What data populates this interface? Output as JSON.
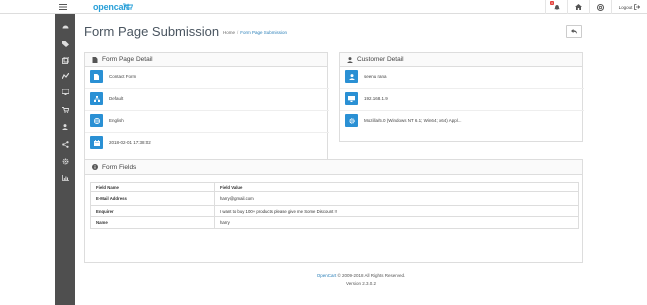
{
  "header": {
    "logo_text": "opencart",
    "notification_count": "4",
    "logout_label": "Logout"
  },
  "sidebar": {
    "items": [
      {
        "icon": "dashboard-icon"
      },
      {
        "icon": "tags-icon"
      },
      {
        "icon": "puzzle-icon"
      },
      {
        "icon": "design-icon"
      },
      {
        "icon": "desktop-icon"
      },
      {
        "icon": "cart-icon"
      },
      {
        "icon": "user-icon"
      },
      {
        "icon": "share-icon"
      },
      {
        "icon": "cog-icon"
      },
      {
        "icon": "chart-icon"
      }
    ]
  },
  "page": {
    "title": "Form Page Submission",
    "breadcrumb": [
      "Home",
      "Form Page Submission"
    ]
  },
  "form_page_detail": {
    "title": "Form Page Detail",
    "rows": [
      {
        "icon": "file-icon",
        "value": "Contact Form"
      },
      {
        "icon": "sitemap-icon",
        "value": "Default"
      },
      {
        "icon": "globe-icon",
        "value": "English"
      },
      {
        "icon": "calendar-icon",
        "value": "2018-02-01 17:38:02"
      }
    ]
  },
  "customer_detail": {
    "title": "Customer Detail",
    "rows": [
      {
        "icon": "user-icon",
        "value": "seenu rana"
      },
      {
        "icon": "desktop-icon",
        "value": "192.168.1.9"
      },
      {
        "icon": "gear-icon",
        "value": "Mozilla/5.0 (Windows NT 6.1; Win64; x64) Appl..."
      }
    ]
  },
  "form_fields": {
    "title": "Form Fields",
    "headers": [
      "Field Name",
      "Field Value"
    ],
    "rows": [
      {
        "name": "E-Mail Address",
        "value": "harry@gmail.com"
      },
      {
        "name": "Enquirer",
        "value": "I want to buy 100+ products please give me Some Discount !!"
      },
      {
        "name": "Name",
        "value": "harry"
      }
    ]
  },
  "footer": {
    "brand": "OpenCart",
    "copyright": " © 2009-2018 All Rights Reserved.",
    "version": "Version 2.3.0.2"
  }
}
